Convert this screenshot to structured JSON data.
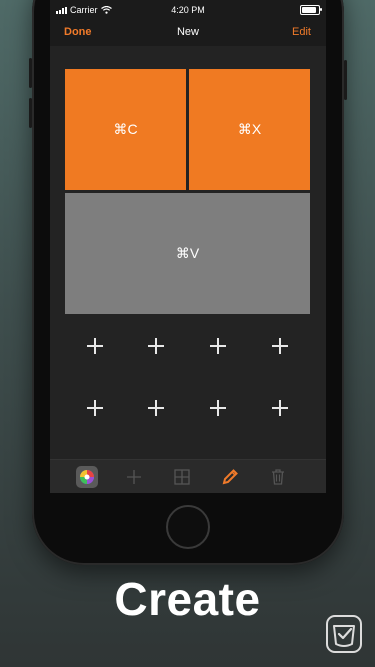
{
  "status_bar": {
    "carrier": "Carrier",
    "time": "4:20 PM",
    "battery_level": 0.9
  },
  "nav": {
    "done_label": "Done",
    "title": "New",
    "edit_label": "Edit"
  },
  "keys": [
    {
      "label": "⌘C",
      "color": "#f07a22"
    },
    {
      "label": "⌘X",
      "color": "#f07a22"
    },
    {
      "label": "⌘V",
      "color": "#7e7e7e"
    }
  ],
  "empty_slots": 8,
  "toolbar": {
    "items": [
      {
        "icon": "color-picker-icon",
        "enabled": true
      },
      {
        "icon": "add-icon",
        "enabled": false
      },
      {
        "icon": "grid-icon",
        "enabled": false
      },
      {
        "icon": "pencil-icon",
        "enabled": true,
        "active": true
      },
      {
        "icon": "trash-icon",
        "enabled": false
      }
    ],
    "accent": "#f07a2a"
  },
  "caption": "Create",
  "colors": {
    "accent": "#f07a2a",
    "screen_bg": "#1b1b1b",
    "canvas_bg": "#232323"
  }
}
